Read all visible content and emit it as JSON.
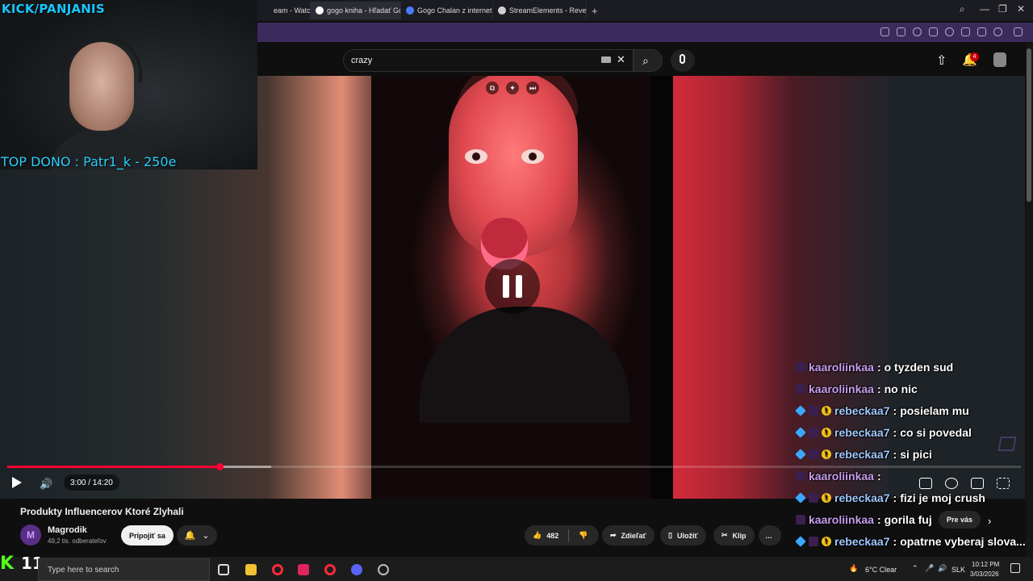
{
  "stream_overlay": {
    "channel_title": "KICK/PANJANIS",
    "top_dono": "TOP DONO : Patr1_k - 250e",
    "kick_count": "11"
  },
  "browser": {
    "tabs": [
      {
        "label": "eam - Watch L",
        "favicon_color": "#6b3fd1"
      },
      {
        "label": "gogo kniha - Hľadať Goo",
        "favicon_color": "#ffffff",
        "active": true
      },
      {
        "label": "Gogo Chalan z internetu",
        "favicon_color": "#4a7bff"
      },
      {
        "label": "StreamElements - Revenu",
        "favicon_color": "#cfcfcf"
      }
    ],
    "new_tab": "+"
  },
  "youtube": {
    "search": {
      "value": "crazy"
    },
    "notifications_count": "4",
    "player": {
      "time": "3:00 / 14:20",
      "progress_fraction": 0.2093,
      "buffered_fraction": 0.26
    },
    "video": {
      "title": "Produkty Influencerov Ktoré Zlyhali",
      "channel": "Magrodik",
      "subscribers": "49,2 tis. odberateľov",
      "subscribe_label": "Pripojiť sa",
      "likes": "482",
      "share_label": "Zdieľať",
      "save_label": "Uložiť",
      "clip_label": "Klip",
      "more_label": "…"
    },
    "recommendation_chip": "Pre vás"
  },
  "chat": [
    {
      "user": "kaaroliinkaa",
      "msg": "o tyzden sud",
      "style": "a"
    },
    {
      "user": "kaaroliinkaa",
      "msg": "no nic",
      "style": "a"
    },
    {
      "user": "rebeckaa7",
      "msg": "posielam mu",
      "style": "b"
    },
    {
      "user": "rebeckaa7",
      "msg": "co si povedal",
      "style": "b"
    },
    {
      "user": "rebeckaa7",
      "msg": "si pici",
      "style": "b"
    },
    {
      "user": "kaaroliinkaa",
      "msg": "",
      "style": "a"
    },
    {
      "user": "rebeckaa7",
      "msg": "fizi je moj crush",
      "style": "b"
    },
    {
      "user": "kaaroliinkaa",
      "msg": "gorila fuj",
      "style": "a"
    },
    {
      "user": "rebeckaa7",
      "msg": "opatrne vyberaj slova...",
      "style": "b"
    }
  ],
  "taskbar": {
    "search_placeholder": "Type here to search",
    "weather": "6°C  Clear",
    "language": "SLK",
    "time": "10:12 PM",
    "date": "3/03/2026"
  },
  "colors": {
    "youtube_red": "#ff0033",
    "kick_green": "#53fc18",
    "chat_a": "#c89ff0",
    "chat_b": "#9fc9ff"
  }
}
